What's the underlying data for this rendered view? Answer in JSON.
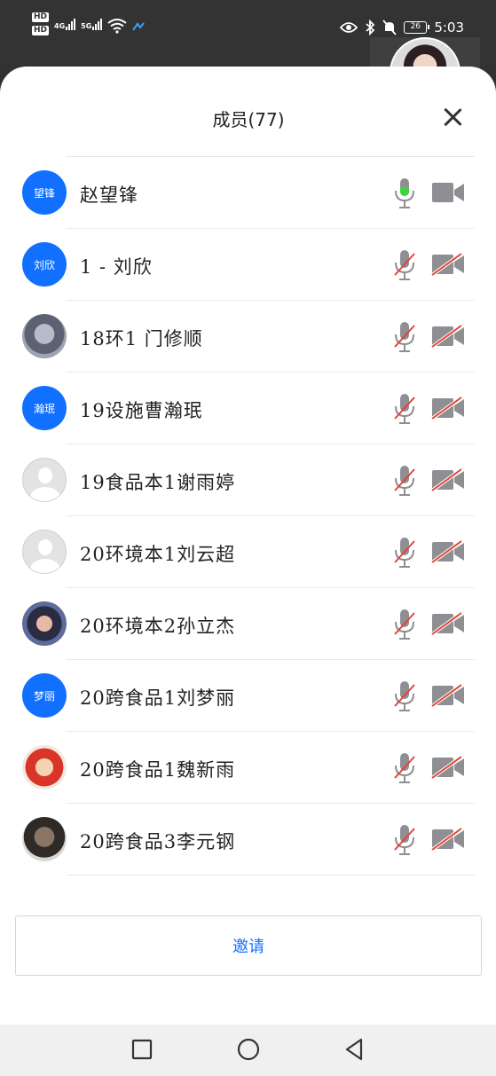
{
  "status_bar": {
    "hd1": "HD",
    "hd2": "HD",
    "net1": "4G",
    "net2": "5G",
    "battery": "26",
    "time": "5:03"
  },
  "sheet": {
    "title": "成员(77)"
  },
  "members": [
    {
      "name": "赵望锋",
      "avatar_type": "text",
      "avatar_text": "望锋",
      "mic": "active"
    },
    {
      "name": "1 - 刘欣",
      "avatar_type": "text",
      "avatar_text": "刘欣",
      "mic": "muted"
    },
    {
      "name": "18环1 门修顺",
      "avatar_type": "photo1",
      "avatar_text": "",
      "mic": "muted"
    },
    {
      "name": "19设施曹瀚珉",
      "avatar_type": "text",
      "avatar_text": "瀚珉",
      "mic": "muted"
    },
    {
      "name": "19食品本1谢雨婷",
      "avatar_type": "default",
      "avatar_text": "",
      "mic": "muted"
    },
    {
      "name": "20环境本1刘云超",
      "avatar_type": "default",
      "avatar_text": "",
      "mic": "muted"
    },
    {
      "name": "20环境本2孙立杰",
      "avatar_type": "photo2",
      "avatar_text": "",
      "mic": "muted"
    },
    {
      "name": "20跨食品1刘梦丽",
      "avatar_type": "text",
      "avatar_text": "梦丽",
      "mic": "muted"
    },
    {
      "name": "20跨食品1魏新雨",
      "avatar_type": "photo3",
      "avatar_text": "",
      "mic": "muted"
    },
    {
      "name": "20跨食品3李元钢",
      "avatar_type": "photo4",
      "avatar_text": "",
      "mic": "muted"
    }
  ],
  "invite": {
    "label": "邀请"
  },
  "colors": {
    "accent": "#1170ff",
    "mic_active": "#3fd43f",
    "muted_slash": "#e0443a",
    "icon_gray": "#8e8e93"
  },
  "icons": {
    "close": "close-icon",
    "mic": "microphone-icon",
    "camera": "camera-icon",
    "nav_recent": "square-icon",
    "nav_home": "circle-icon",
    "nav_back": "triangle-back-icon"
  }
}
